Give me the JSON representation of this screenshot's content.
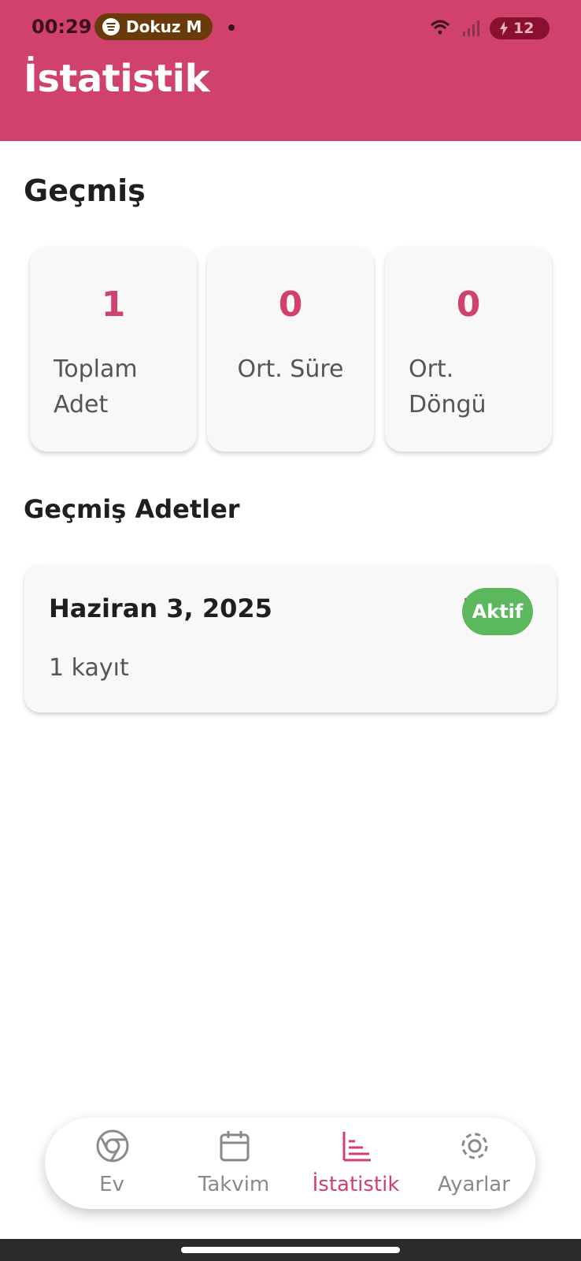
{
  "status_bar": {
    "time": "00:29",
    "media_pill": "Dokuz M",
    "battery": "12"
  },
  "header": {
    "title": "İstatistik"
  },
  "history": {
    "title": "Geçmiş",
    "stats": [
      {
        "value": "1",
        "label": "Toplam Adet"
      },
      {
        "value": "0",
        "label": "Ort. Süre"
      },
      {
        "value": "0",
        "label": "Ort. Döngü"
      }
    ]
  },
  "past_records": {
    "title": "Geçmiş Adetler",
    "items": [
      {
        "date": "Haziran 3, 2025",
        "count": "1 kayıt",
        "peek": "2",
        "badge": "Aktif"
      }
    ]
  },
  "nav": {
    "items": [
      {
        "label": "Ev",
        "icon": "chrome-icon"
      },
      {
        "label": "Takvim",
        "icon": "calendar-icon"
      },
      {
        "label": "İstatistik",
        "icon": "bar-chart-icon",
        "active": true
      },
      {
        "label": "Ayarlar",
        "icon": "gear-icon"
      }
    ]
  },
  "colors": {
    "primary": "#d0416c",
    "active_badge": "#5cb85c",
    "card_bg": "#f8f8f8"
  }
}
